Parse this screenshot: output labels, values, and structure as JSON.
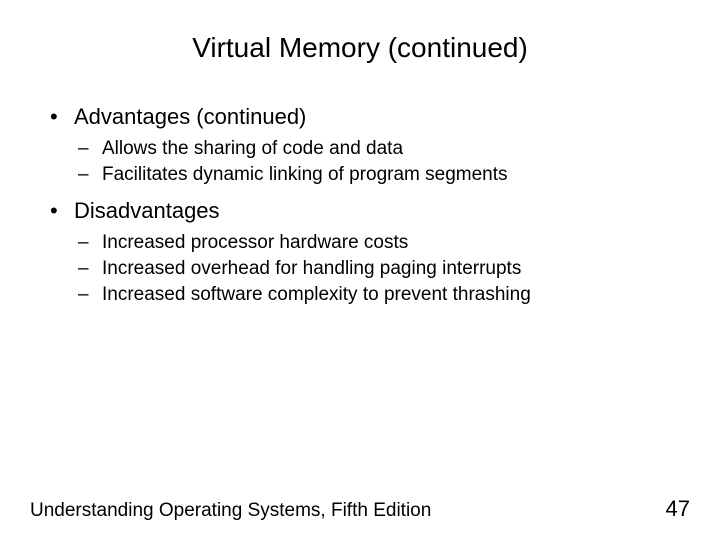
{
  "slide": {
    "title": "Virtual Memory (continued)",
    "bullets": {
      "advantages_label": "Advantages (continued)",
      "adv_1": "Allows the sharing of code and data",
      "adv_2": "Facilitates dynamic linking of program segments",
      "disadvantages_label": "Disadvantages",
      "dis_1": "Increased processor hardware costs",
      "dis_2": "Increased overhead for handling paging interrupts",
      "dis_3": "Increased software complexity to prevent thrashing"
    },
    "footer_text": "Understanding Operating Systems, Fifth Edition",
    "page_number": "47"
  }
}
